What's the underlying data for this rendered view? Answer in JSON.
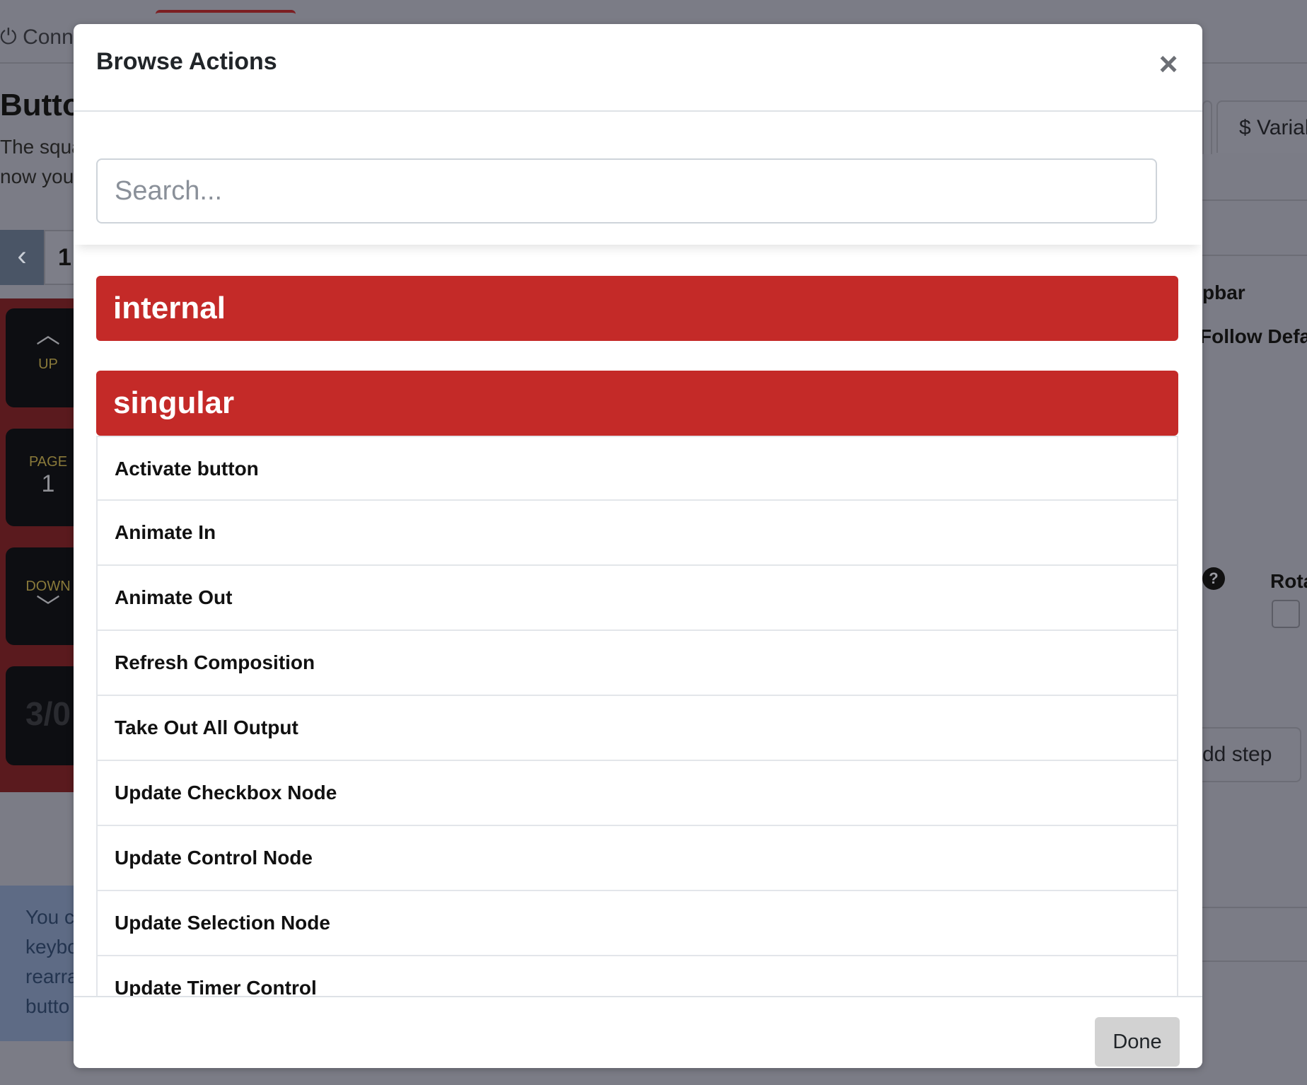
{
  "background": {
    "connection_label": "Conne",
    "page_title": "Butto",
    "description_line1": "The squa",
    "description_line2": "now you",
    "pager_prev_glyph": "‹",
    "pager_page": "1",
    "keys": [
      {
        "top_label": "UP",
        "glyph": "︿"
      },
      {
        "top_label": "PAGE",
        "value": "1"
      },
      {
        "top_label": "DOWN",
        "glyph": "﹀"
      },
      {
        "value": "3/0"
      }
    ],
    "info_text": "You c keybo rearra butto",
    "right_tabs": [
      {
        "label": ""
      },
      {
        "label": "$ Varial"
      }
    ],
    "right_texts": [
      "pbar",
      "Follow Defa",
      "Rota"
    ],
    "help_glyph": "?",
    "add_step_label": "dd step"
  },
  "modal": {
    "title": "Browse Actions",
    "close_glyph": "×",
    "search_placeholder": "Search...",
    "search_value": "",
    "groups": [
      {
        "label": "internal"
      },
      {
        "label": "singular"
      }
    ],
    "actions": [
      "Activate button",
      "Animate In",
      "Animate Out",
      "Refresh Composition",
      "Take Out All Output",
      "Update Checkbox Node",
      "Update Control Node",
      "Update Selection Node",
      "Update Timer Control"
    ],
    "done_label": "Done"
  },
  "colors": {
    "group_header": "#c42a28",
    "overlay": "#7b7c86",
    "done_button": "#d2d2d2"
  }
}
